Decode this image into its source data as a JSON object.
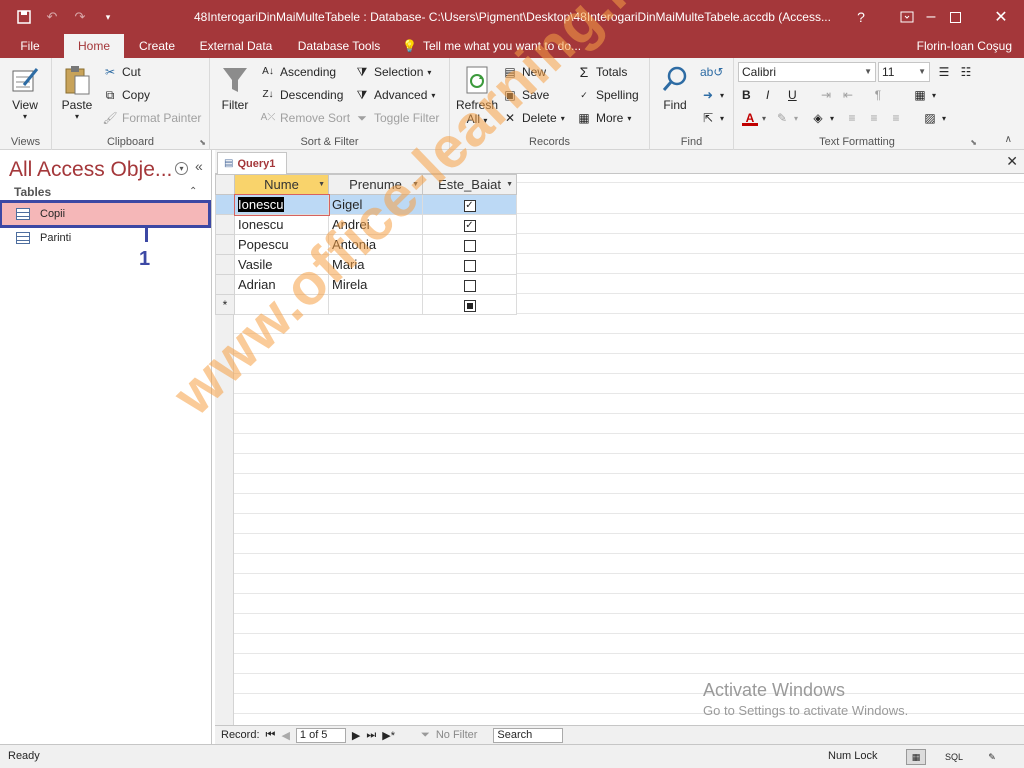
{
  "window": {
    "title": "48InterogariDinMaiMulteTabele : Database- C:\\Users\\Pigment\\Desktop\\48InterogariDinMaiMulteTabele.accdb (Access...",
    "help": "?",
    "user": "Florin-Ioan Coşug"
  },
  "tabs": {
    "file": "File",
    "home": "Home",
    "create": "Create",
    "external": "External Data",
    "dbtools": "Database Tools",
    "tellme": "Tell me what you want to do..."
  },
  "ribbon": {
    "views": {
      "view": "View",
      "label": "Views"
    },
    "clipboard": {
      "paste": "Paste",
      "cut": "Cut",
      "copy": "Copy",
      "format_painter": "Format Painter",
      "label": "Clipboard"
    },
    "sort": {
      "filter": "Filter",
      "ascending": "Ascending",
      "descending": "Descending",
      "remove_sort": "Remove Sort",
      "selection": "Selection",
      "advanced": "Advanced",
      "toggle_filter": "Toggle Filter",
      "label": "Sort & Filter"
    },
    "records": {
      "refresh": "Refresh",
      "refresh_all": "All",
      "new": "New",
      "save": "Save",
      "delete": "Delete",
      "totals": "Totals",
      "spelling": "Spelling",
      "more": "More",
      "label": "Records"
    },
    "find": {
      "find": "Find",
      "label": "Find"
    },
    "text": {
      "font": "Calibri",
      "size": "11",
      "bold": "B",
      "italic": "I",
      "underline": "U",
      "label": "Text Formatting"
    }
  },
  "nav": {
    "title": "All Access Obje...",
    "section": "Tables",
    "items": [
      {
        "label": "Copii"
      },
      {
        "label": "Parinti"
      }
    ],
    "annotation": "1"
  },
  "doc": {
    "tab": "Query1",
    "columns": [
      "Nume",
      "Prenume",
      "Este_Baiat"
    ],
    "rows": [
      {
        "nume": "Ionescu",
        "prenume": "Gigel",
        "baiat": true
      },
      {
        "nume": "Ionescu",
        "prenume": "Andrei",
        "baiat": true
      },
      {
        "nume": "Popescu",
        "prenume": "Antonia",
        "baiat": false
      },
      {
        "nume": "Vasile",
        "prenume": "Maria",
        "baiat": false
      },
      {
        "nume": "Adrian",
        "prenume": "Mirela",
        "baiat": false
      }
    ],
    "new_row_marker": "*",
    "record_nav": {
      "label": "Record:",
      "position": "1 of 5",
      "filter": "No Filter",
      "search": "Search"
    }
  },
  "watermark": "www.office-learning.ro",
  "activation": {
    "line1": "Activate Windows",
    "line2": "Go to Settings to activate Windows."
  },
  "status": {
    "ready": "Ready",
    "numlock": "Num Lock",
    "sql": "SQL"
  },
  "colors": {
    "accent": "#a4373a",
    "selection_outline": "#3c48a4",
    "selected_item": "#f5b7b8",
    "watermark": "#f5a046"
  }
}
